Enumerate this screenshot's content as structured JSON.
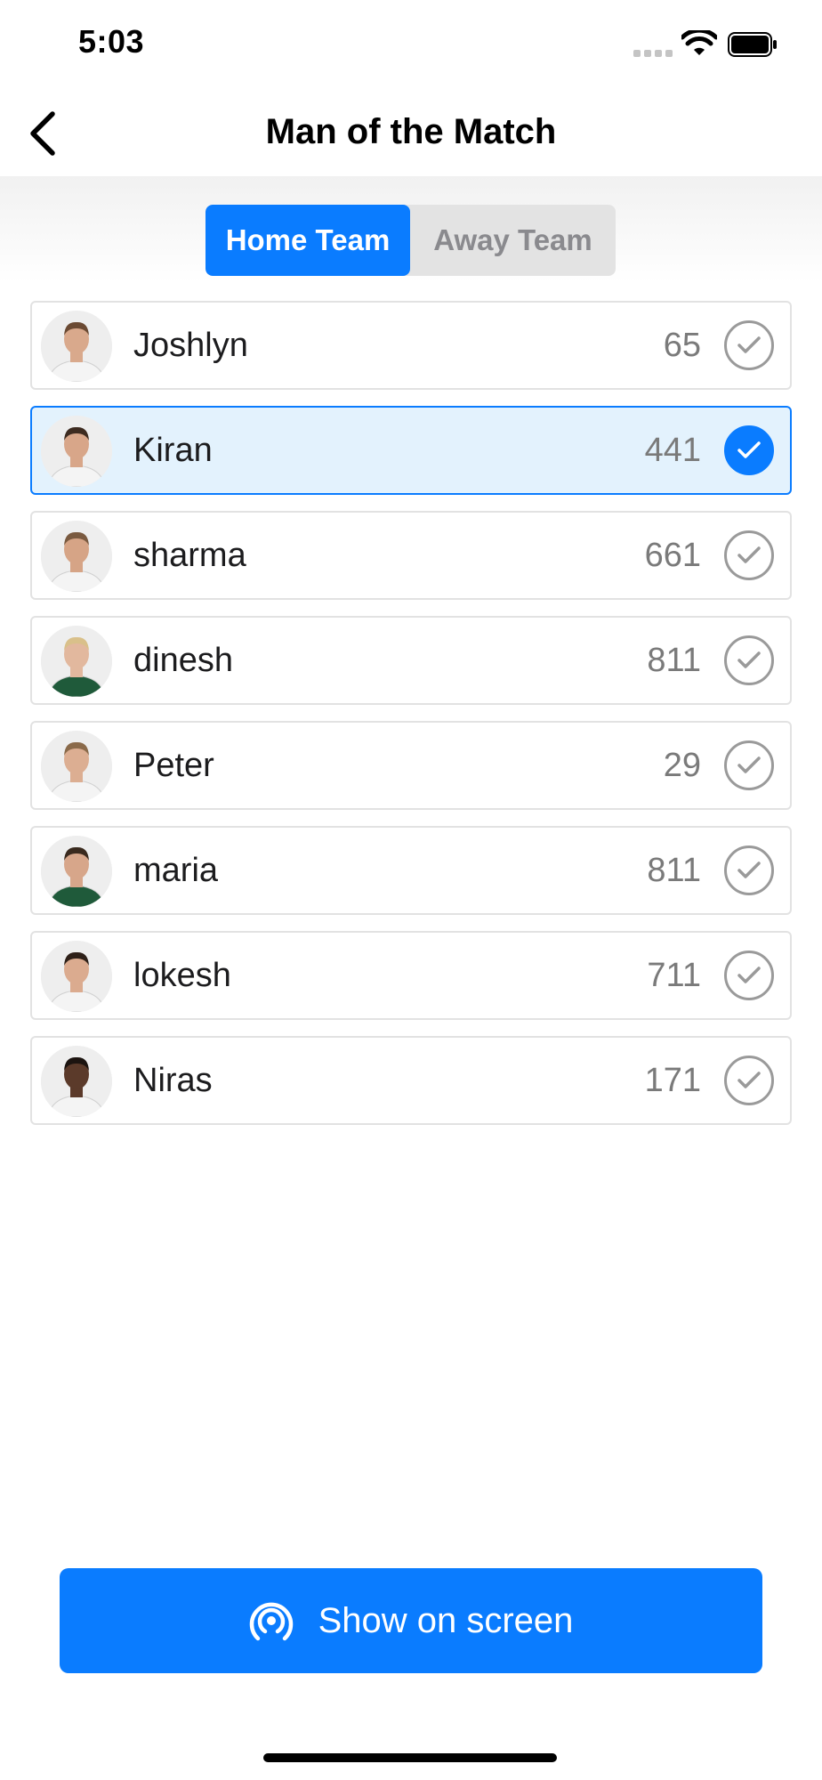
{
  "status_bar": {
    "time": "5:03"
  },
  "nav": {
    "title": "Man of the Match",
    "back_icon": "chevron-left-icon"
  },
  "segments": {
    "home_label": "Home Team",
    "away_label": "Away Team",
    "selected": "Home Team"
  },
  "players": [
    {
      "name": "Joshlyn",
      "votes": "65",
      "selected": false
    },
    {
      "name": "Kiran",
      "votes": "441",
      "selected": true
    },
    {
      "name": "sharma",
      "votes": "661",
      "selected": false
    },
    {
      "name": "dinesh",
      "votes": "811",
      "selected": false
    },
    {
      "name": "Peter",
      "votes": "29",
      "selected": false
    },
    {
      "name": "maria",
      "votes": "811",
      "selected": false
    },
    {
      "name": "lokesh",
      "votes": "711",
      "selected": false
    },
    {
      "name": "Niras",
      "votes": "171",
      "selected": false
    }
  ],
  "action": {
    "label": "Show on screen",
    "icon": "broadcast-icon"
  },
  "colors": {
    "accent": "#0a7cff",
    "selected_row_bg": "#e3f2fd"
  }
}
